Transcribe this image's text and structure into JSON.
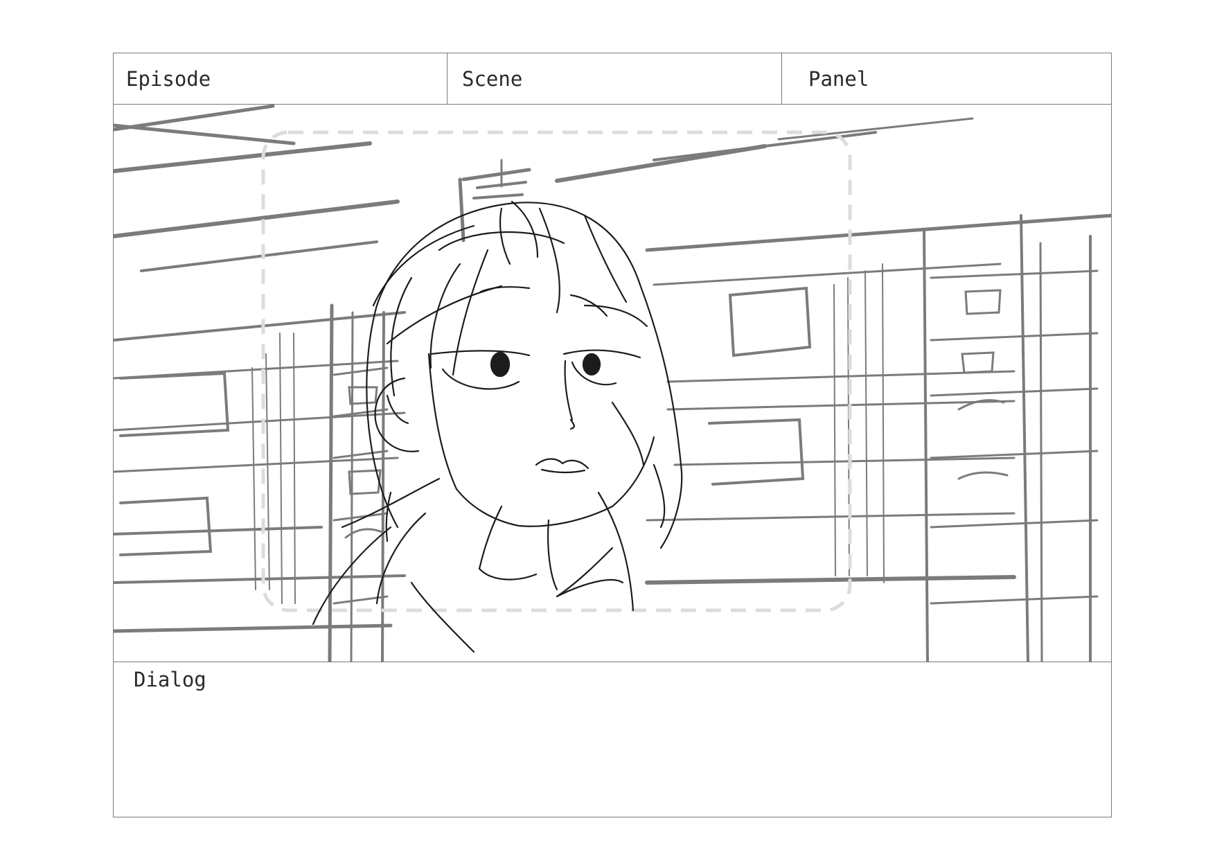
{
  "board": {
    "episode_label": "Episode",
    "scene_label": "Scene",
    "panel_label": "Panel",
    "dialog_label": "Dialog"
  },
  "colors": {
    "border": "#7a7a7a",
    "sketch_background": "#7b7b7b",
    "sketch_character": "#1c1c1c",
    "safe_area_guide": "#dcdcdc"
  }
}
